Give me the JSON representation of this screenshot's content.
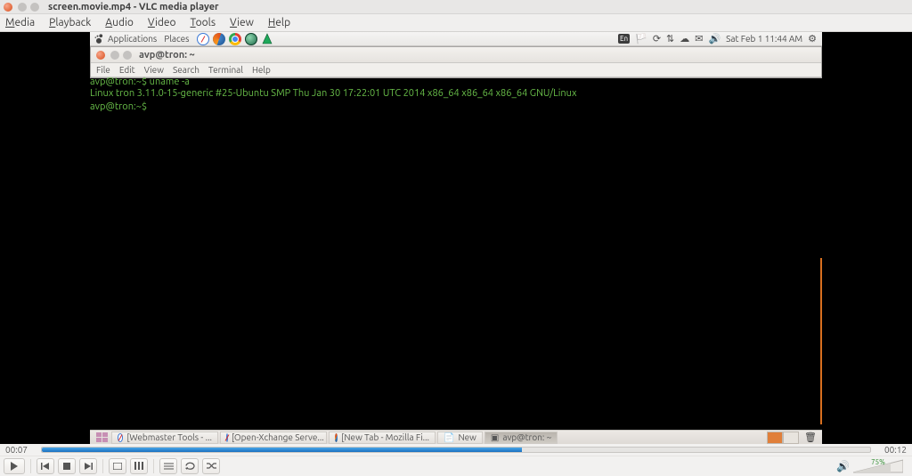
{
  "vlc": {
    "title": "screen.movie.mp4 - VLC media player",
    "menu": [
      "Media",
      "Playback",
      "Audio",
      "Video",
      "Tools",
      "View",
      "Help"
    ],
    "time_current": "00:07",
    "time_total": "00:12",
    "seek_percent": 58,
    "volume_percent": "75%"
  },
  "ubuntu_panel": {
    "applications": "Applications",
    "places": "Places",
    "lang": "En",
    "clock": "Sat Feb 1  11:44 AM"
  },
  "terminal": {
    "title": "avp@tron: ~",
    "menu": [
      "File",
      "Edit",
      "View",
      "Search",
      "Terminal",
      "Help"
    ],
    "prompt": "avp@tron:~$",
    "cmd": "uname -a",
    "out": "Linux tron 3.11.0-15-generic #25-Ubuntu SMP Thu Jan 30 17:22:01 UTC 2014 x86_64 x86_64 x86_64 GNU/Linux"
  },
  "taskbar": {
    "items": [
      {
        "label": "[Webmaster Tools - ..."
      },
      {
        "label": "[Open-Xchange Serve..."
      },
      {
        "label": "[New Tab - Mozilla Fi..."
      },
      {
        "label": "New"
      },
      {
        "label": "avp@tron: ~",
        "active": true
      }
    ]
  }
}
